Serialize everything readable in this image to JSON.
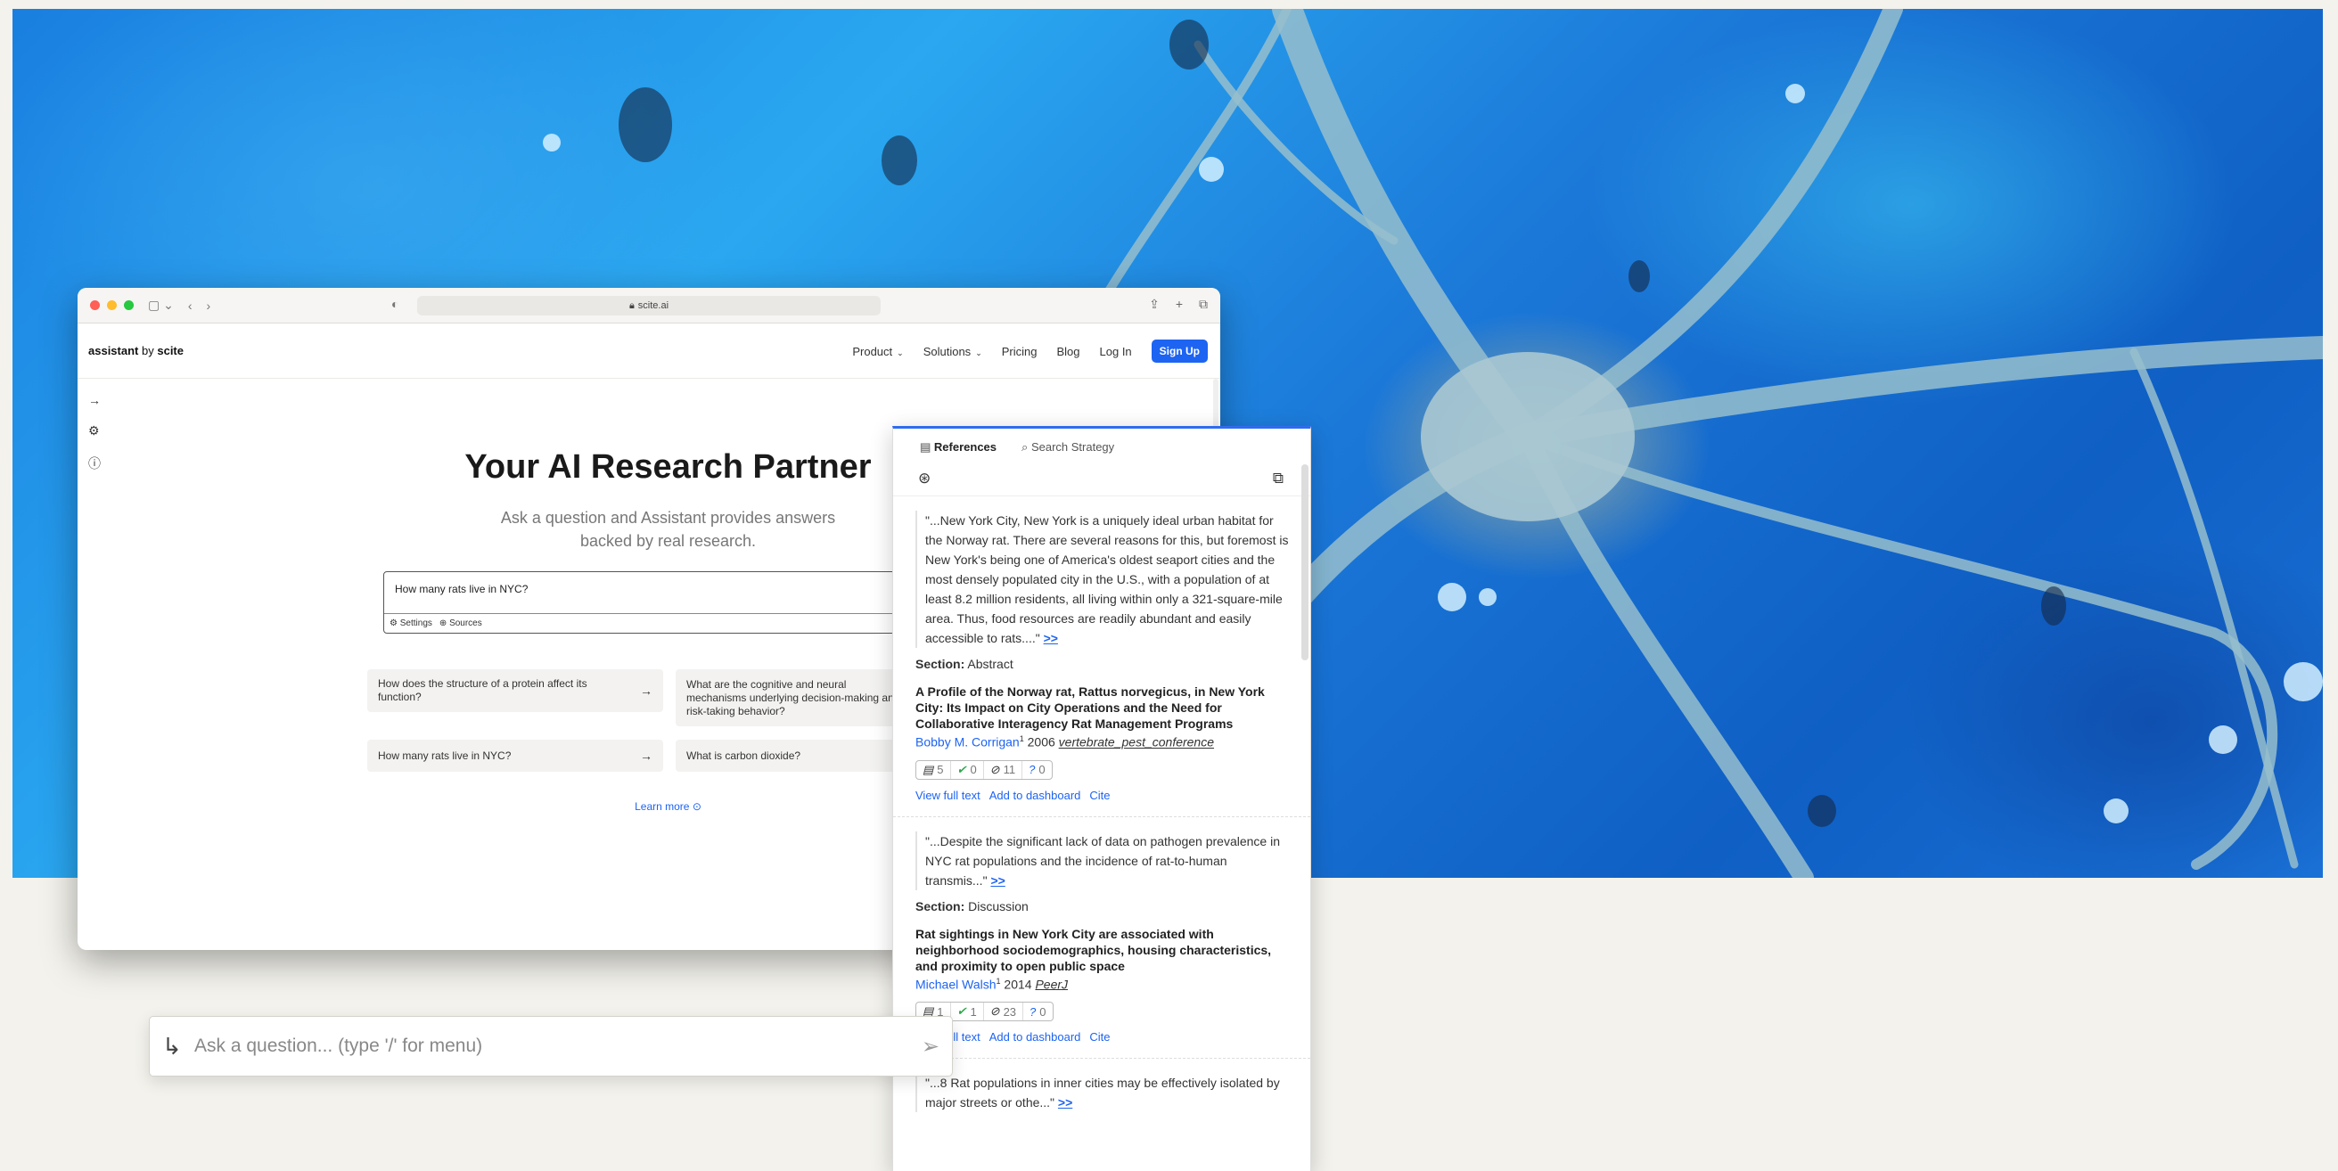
{
  "browser": {
    "url": "scite.ai"
  },
  "header": {
    "logo_main": "assistant",
    "logo_by": "by",
    "logo_brand": "scite",
    "nav": [
      "Product",
      "Solutions",
      "Pricing",
      "Blog",
      "Log In"
    ],
    "signup": "Sign Up"
  },
  "hero": {
    "title": "Your AI Research Partner",
    "subtitle_line1": "Ask a question and Assistant provides answers",
    "subtitle_line2": "backed by real research.",
    "query": "How many rats live in NYC?",
    "settings_label": "Settings",
    "sources_label": "Sources",
    "learn_more": "Learn more"
  },
  "suggestions": [
    "How does the structure of a protein affect its function?",
    "What are the cognitive and neural mechanisms underlying decision-making and risk-taking behavior?",
    "How many rats live in NYC?",
    "What is carbon dioxide?"
  ],
  "references_panel": {
    "tab_references": "References",
    "tab_strategy": "Search Strategy",
    "refs": [
      {
        "quote": "\"...New York City, New York is a uniquely ideal urban habitat for the Norway rat. There are several reasons for this, but foremost is New York's being one of America's oldest seaport cities and the most densely populated city in the U.S., with a population of at least 8.2 million residents, all living within only a 321-square-mile area. Thus, food resources are readily abundant and easily accessible to rats....\"",
        "more": ">>",
        "section_label": "Section:",
        "section": "Abstract",
        "title": "A Profile of the Norway rat, Rattus norvegicus, in New York City: Its Impact on City Operations and the Need for Collaborative Interagency Rat Management Programs",
        "author": "Bobby M. Corrigan",
        "sup": "1",
        "year": "2006",
        "journal": "vertebrate_pest_conference",
        "tally": [
          "5",
          "0",
          "11",
          "0"
        ],
        "actions": [
          "View full text",
          "Add to dashboard",
          "Cite"
        ]
      },
      {
        "quote": "\"...Despite the significant lack of data on pathogen prevalence in NYC rat populations and the incidence of rat-to-human transmis...\"",
        "more": ">>",
        "section_label": "Section:",
        "section": "Discussion",
        "title": "Rat sightings in New York City are associated with neighborhood sociodemographics, housing characteristics, and proximity to open public space",
        "author": "Michael Walsh",
        "sup": "1",
        "year": "2014",
        "journal": "PeerJ",
        "tally": [
          "1",
          "1",
          "23",
          "0"
        ],
        "actions": [
          "View full text",
          "Add to dashboard",
          "Cite"
        ]
      },
      {
        "quote": "\"...8 Rat populations in inner cities may be effectively isolated by major streets or othe...\"",
        "more": ">>"
      }
    ]
  },
  "ask_bar": {
    "placeholder": "Ask a question... (type '/' for menu)"
  }
}
